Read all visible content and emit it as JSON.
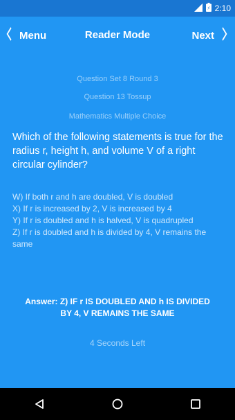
{
  "status_bar": {
    "time": "2:10",
    "icons": [
      "signal-icon",
      "battery-icon"
    ]
  },
  "app_bar": {
    "back_label": "Menu",
    "title": "Reader Mode",
    "next_label": "Next"
  },
  "question": {
    "set": "Question Set 8 Round 3",
    "number": "Question 13 Tossup",
    "type": "Mathematics Multiple Choice",
    "text": "Which of the following statements is true for the radius r, height h, and volume V of a right circular cylinder?",
    "choices": [
      "W) If both r and h are doubled, V is doubled",
      "X) If r is increased by 2, V is increased by 4",
      "Y) If r is doubled and h is halved, V is quadrupled",
      "Z) If r is doubled and h is divided by 4, V remains the same"
    ],
    "answer": "Answer: Z) IF r IS DOUBLED AND h IS DIVIDED BY 4, V REMAINS THE SAME",
    "timer": "4 Seconds Left"
  },
  "colors": {
    "background": "#2196F3",
    "status_bar": "#1976D2",
    "nav_bar": "#000000"
  }
}
